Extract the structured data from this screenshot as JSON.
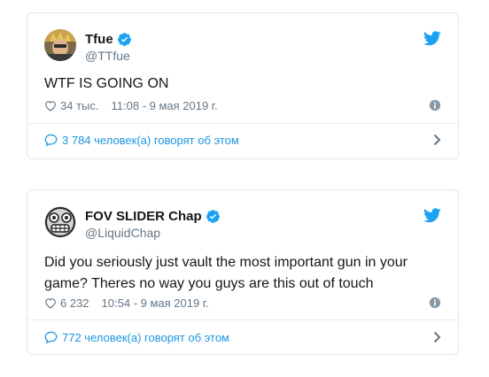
{
  "colors": {
    "accent": "#1da1f2",
    "link": "#1b95e0",
    "muted": "#657786",
    "border": "#e1e8ed"
  },
  "tweets": [
    {
      "display_name": "Tfue",
      "handle": "@TTfue",
      "verified": true,
      "text": "WTF IS GOING ON",
      "likes": "34 тыс.",
      "timestamp": "11:08 - 9 мая 2019 г.",
      "talk": "3 784 человек(а) говорят об этом",
      "avatar_icon": "tfue-avatar",
      "brand_icon": "twitter-bird-icon"
    },
    {
      "display_name": "FOV SLIDER Chap",
      "handle": "@LiquidChap",
      "verified": true,
      "text": "Did you seriously just vault the most important gun in your game? Theres no way you guys are this out of touch",
      "likes": "6 232",
      "timestamp": "10:54 - 9 мая 2019 г.",
      "talk": "772 человек(а) говорят об этом",
      "avatar_icon": "grimace-emoji-avatar",
      "brand_icon": "twitter-bird-icon"
    }
  ]
}
